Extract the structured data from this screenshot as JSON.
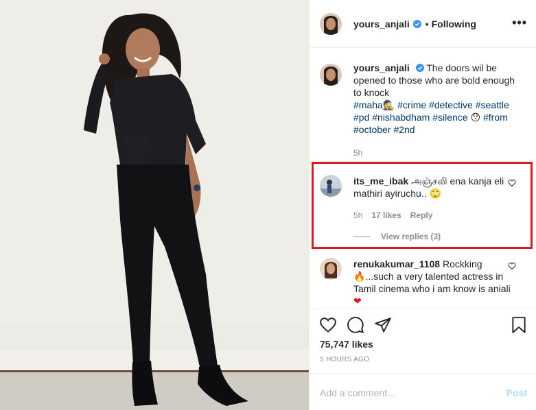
{
  "header": {
    "username": "yours_anjali",
    "separator": "•",
    "follow_label": "Following",
    "more_icon": "more-horizontal-icon",
    "more_glyph": "•••"
  },
  "caption": {
    "username": "yours_anjali",
    "text": "The doors wil be opened to those who are bold enough to knock",
    "hashtags_line1": "#maha",
    "emoji_detective": "🕵",
    "hashtags_rest": "#crime #detective #seattle #pd #nishabdham #silence",
    "emoji_hushed": "😯",
    "hashtags_end": "#from #october #2nd",
    "time": "5h"
  },
  "highlighted_comment": {
    "username": "its_me_ibak",
    "text": "அஞ்சலி ena kanja eli mathiri ayiruchu..",
    "emoji": "🙄",
    "time": "5h",
    "likes": "17 likes",
    "reply_label": "Reply",
    "view_replies": "View replies (3)"
  },
  "comment2": {
    "username": "renukakumar_1108",
    "text_1": "Rockking",
    "emoji_fire": "🔥",
    "text_2": "...such a very talented actress in Tamil cinema who i am know is aniali",
    "emoji_heart": "❤"
  },
  "actions": {
    "likes": "75,747 likes",
    "time_ago": "5 HOURS AGO",
    "icons": [
      "heart-icon",
      "comment-icon",
      "share-icon",
      "bookmark-icon"
    ]
  },
  "add_comment": {
    "placeholder": "Add a comment...",
    "post_label": "Post"
  },
  "colors": {
    "highlight_border": "#e0191e",
    "hashtag": "#00376b",
    "muted": "#8e8e8e",
    "post_button": "#b3dbff",
    "verified": "#3897f0"
  }
}
